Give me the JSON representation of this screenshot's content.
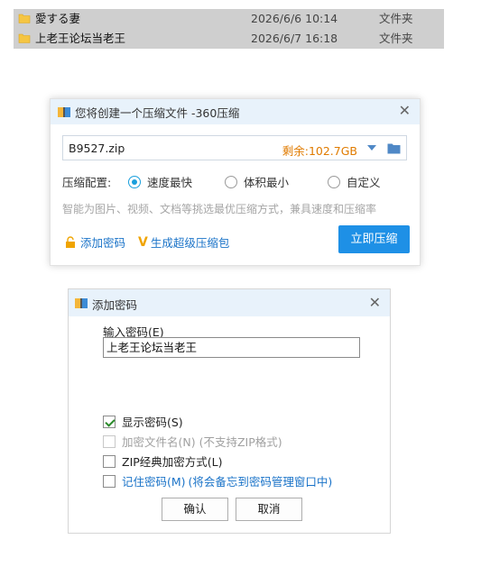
{
  "file_list": [
    {
      "name": "愛する妻",
      "date": "2026/6/6 10:14",
      "type": "文件夹"
    },
    {
      "name": "上老王论坛当老王",
      "date": "2026/6/7 16:18",
      "type": "文件夹"
    }
  ],
  "compress_dialog": {
    "title": "您将创建一个压缩文件 -360压缩",
    "close": "✕",
    "file_name": "B9527.zip",
    "free_space": "剩余:102.7GB",
    "option_label": "压缩配置:",
    "options": [
      "速度最快",
      "体积最小",
      "自定义"
    ],
    "selected_option": "速度最快",
    "hint": "智能为图片、视频、文档等挑选最优压缩方式，兼具速度和压缩率",
    "add_password": "添加密码",
    "create_super": "生成超级压缩包",
    "compress_button": "立即压缩",
    "accent_color": "#1e90e6"
  },
  "password_dialog": {
    "title": "添加密码",
    "close": "✕",
    "input_label": "输入密码(E)",
    "password_value": "上老王论坛当老王",
    "checkboxes": [
      {
        "label": "显示密码(S)",
        "checked": true,
        "enabled": true
      },
      {
        "label": "加密文件名(N) (不支持ZIP格式)",
        "checked": false,
        "enabled": false
      },
      {
        "label": "ZIP经典加密方式(L)",
        "checked": false,
        "enabled": true
      },
      {
        "label": "记住密码(M)",
        "extra": "(将会备忘到密码管理窗口中)",
        "checked": false,
        "enabled": true
      }
    ],
    "ok_button": "确认",
    "cancel_button": "取消"
  }
}
